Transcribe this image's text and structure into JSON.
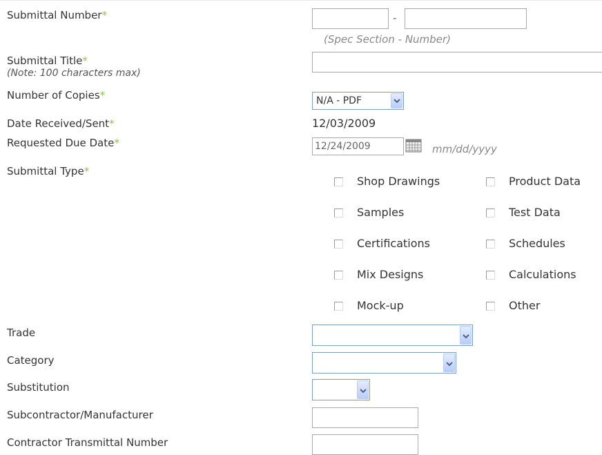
{
  "labels": {
    "submittal_number": "Submittal Number",
    "submittal_title": "Submittal Title",
    "title_note": "(Note: 100 characters max)",
    "number_of_copies": "Number of Copies",
    "date_received": "Date Received/Sent",
    "requested_due_date": "Requested Due Date",
    "submittal_type": "Submittal Type",
    "trade": "Trade",
    "category": "Category",
    "substitution": "Substitution",
    "subcontractor": "Subcontractor/Manufacturer",
    "transmittal_number": "Contractor Transmittal Number",
    "required_mark": "*"
  },
  "submittal_number": {
    "spec_section": "",
    "number": "",
    "separator": "-",
    "hint": "(Spec Section - Number)"
  },
  "submittal_title_value": "",
  "copies_selected": "N/A - PDF",
  "date_received_value": "12/03/2009",
  "due_date": {
    "value": "12/24/2009",
    "format_hint": "mm/dd/yyyy"
  },
  "submittal_types": {
    "shop_drawings": "Shop Drawings",
    "product_data": "Product Data",
    "samples": "Samples",
    "test_data": "Test Data",
    "certifications": "Certifications",
    "schedules": "Schedules",
    "mix_designs": "Mix Designs",
    "calculations": "Calculations",
    "mock_up": "Mock-up",
    "other": "Other"
  },
  "trade_selected": "",
  "category_selected": "",
  "substitution_selected": "",
  "subcontractor_value": "",
  "transmittal_value": "",
  "colors": {
    "required": "#8cc63f",
    "input_border": "#a7a6aa",
    "select_border": "#7f9db9"
  }
}
